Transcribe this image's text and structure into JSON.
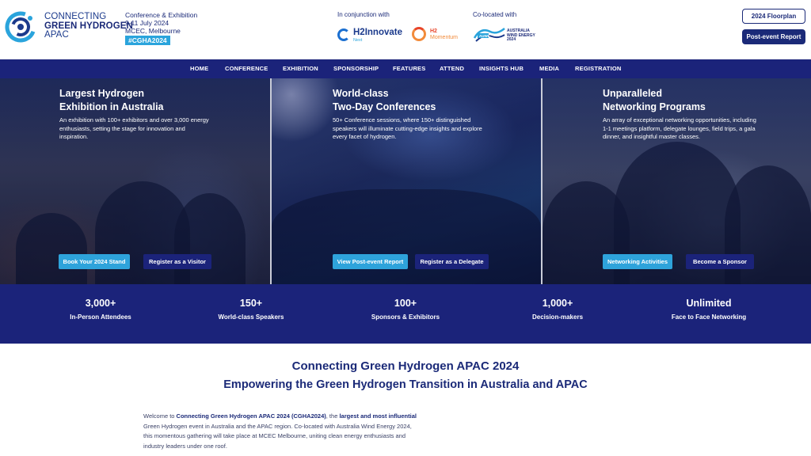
{
  "header": {
    "logo": {
      "line1": "CONNECTING",
      "line2": "GREEN HYDROGEN",
      "line3": "APAC"
    },
    "event": {
      "type": "Conference & Exhibition",
      "dates": "9-11 July 2024",
      "venue": "MCEC, Melbourne",
      "hashtag": "#CGHA2024"
    },
    "partners": {
      "conjunction_label": "In conjunction with",
      "colocated_label": "Co-located with",
      "h2innovate_title": "H2Innovate",
      "h2innovate_sub": "Next",
      "h2momentum_title": "H2",
      "h2momentum_sub": "Momentum",
      "awe_text_1": "AUSTRALIA",
      "awe_text_2": "WIND ENERGY",
      "awe_text_3": "2024"
    },
    "buttons": {
      "floorplan": "2024 Floorplan",
      "report": "Post-event Report"
    }
  },
  "nav": {
    "items": [
      "HOME",
      "CONFERENCE",
      "EXHIBITION",
      "SPONSORSHIP",
      "FEATURES",
      "ATTEND",
      "INSIGHTS HUB",
      "MEDIA",
      "REGISTRATION"
    ]
  },
  "hero": {
    "panels": [
      {
        "title_1": "Largest Hydrogen",
        "title_2": "Exhibition in Australia",
        "desc": "An exhibition with 100+ exhibitors and over 3,000 energy enthusiasts, setting the stage for innovation and inspiration.",
        "btn_primary": "Book Your 2024 Stand",
        "btn_secondary": "Register as a Visitor"
      },
      {
        "title_1": "World-class",
        "title_2": "Two-Day Conferences",
        "desc": "50+ Conference sessions, where 150+ distinguished speakers will illuminate cutting-edge insights and explore every facet of hydrogen.",
        "btn_primary": "View Post-event Report",
        "btn_secondary": "Register as a Delegate"
      },
      {
        "title_1": "Unparalleled",
        "title_2": "Networking Programs",
        "desc": "An array of exceptional networking opportunities, including 1-1 meetings platform, delegate lounges, field trips, a gala dinner, and insightful master classes.",
        "btn_primary": "Networking Activities",
        "btn_secondary": "Become a Sponsor"
      }
    ]
  },
  "stats": [
    {
      "value": "3,000+",
      "label": "In-Person Attendees"
    },
    {
      "value": "150+",
      "label": "World-class Speakers"
    },
    {
      "value": "100+",
      "label": "Sponsors & Exhibitors"
    },
    {
      "value": "1,000+",
      "label": "Decision-makers"
    },
    {
      "value": "Unlimited",
      "label": "Face to Face Networking"
    }
  ],
  "intro": {
    "title": "Connecting Green Hydrogen APAC 2024",
    "subtitle": "Empowering the Green Hydrogen Transition in Australia and APAC",
    "body_1": "Welcome to ",
    "body_2": "Connecting Green Hydrogen APAC 2024 (CGHA2024)",
    "body_3": ", the ",
    "body_4": "largest and most influential",
    "body_5": " Green Hydrogen event in Australia and the APAC region. Co-located with Australia Wind Energy 2024, this momentous gathering will take place at MCEC Melbourne, uniting clean energy enthusiasts and industry leaders under one roof."
  },
  "colors": {
    "navy": "#1b237a",
    "cyan": "#2ea3db",
    "white": "#ffffff"
  },
  "icons": [
    "logo-icon",
    "h2innovate-icon",
    "h2momentum-icon",
    "awe-icon"
  ]
}
